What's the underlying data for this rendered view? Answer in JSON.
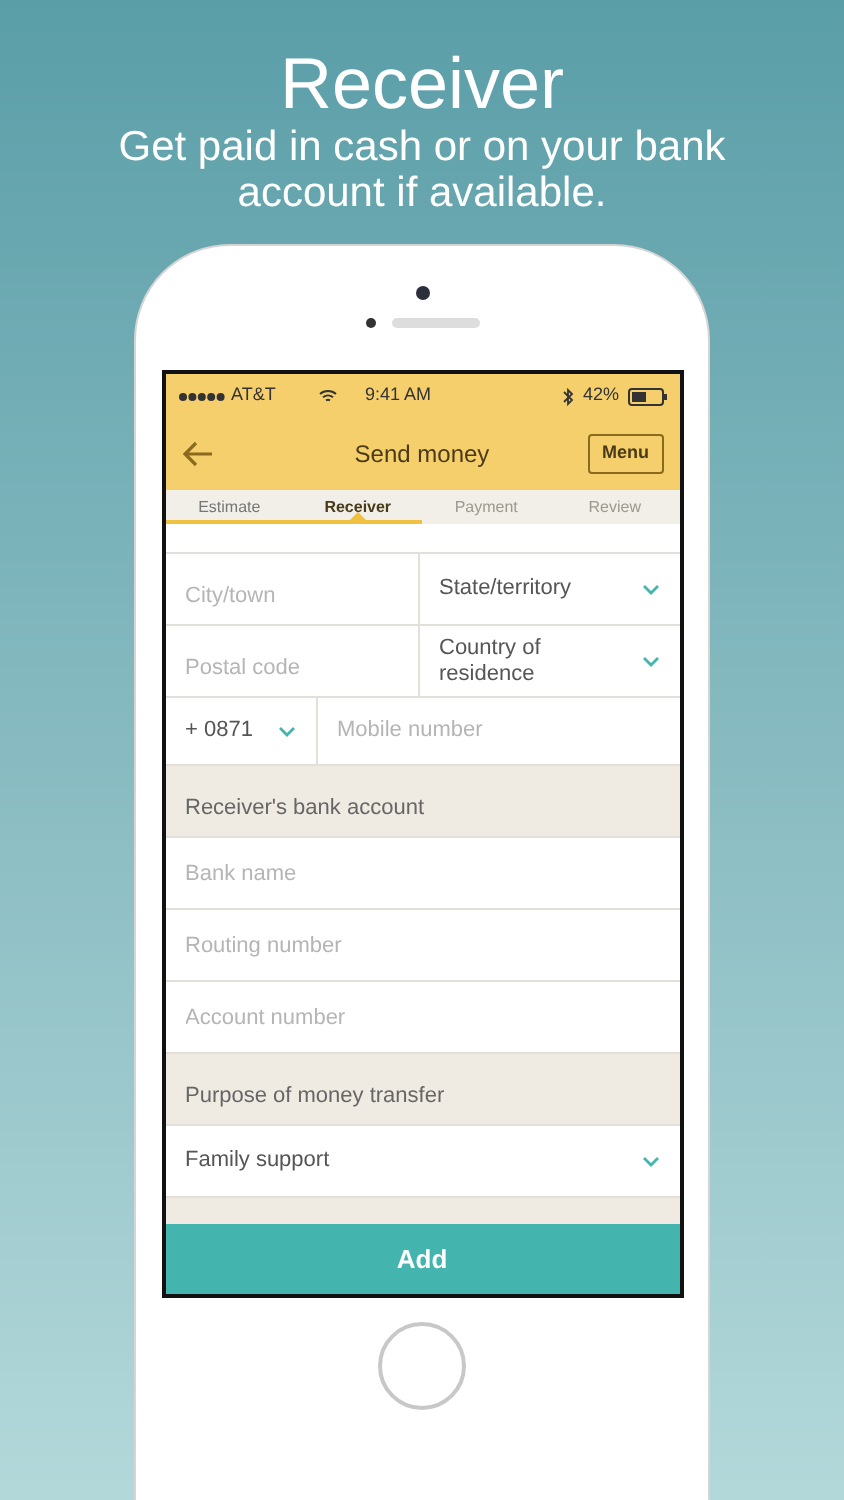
{
  "header": {
    "title": "Receiver",
    "subtitle": "Get paid in cash or on your bank account if available."
  },
  "status_bar": {
    "carrier": "AT&T",
    "time": "9:41 AM",
    "battery": "42%"
  },
  "nav": {
    "title": "Send money",
    "menu": "Menu"
  },
  "steps": [
    {
      "label": "Estimate",
      "selected": false
    },
    {
      "label": "Receiver",
      "selected": true
    },
    {
      "label": "Payment",
      "selected": false
    },
    {
      "label": "Review",
      "selected": false
    }
  ],
  "form": [
    {
      "kind": "pair",
      "cells": [
        {
          "kind": "input",
          "placeholder": "City/town"
        },
        {
          "kind": "select",
          "label": "State/territory"
        }
      ]
    },
    {
      "kind": "pair",
      "cells": [
        {
          "kind": "input",
          "placeholder": "Postal code"
        },
        {
          "kind": "select",
          "label": "Country of residence"
        }
      ]
    },
    {
      "kind": "phone",
      "code": "+ 0871",
      "placeholder": "Mobile number"
    },
    {
      "kind": "section",
      "label": "Receiver's bank account"
    },
    {
      "kind": "input",
      "placeholder": "Bank name"
    },
    {
      "kind": "input",
      "placeholder": "Routing number"
    },
    {
      "kind": "input",
      "placeholder": "Account number"
    },
    {
      "kind": "section",
      "label": "Purpose of money transfer"
    },
    {
      "kind": "select",
      "label": "Family support"
    }
  ],
  "submit": "Add"
}
